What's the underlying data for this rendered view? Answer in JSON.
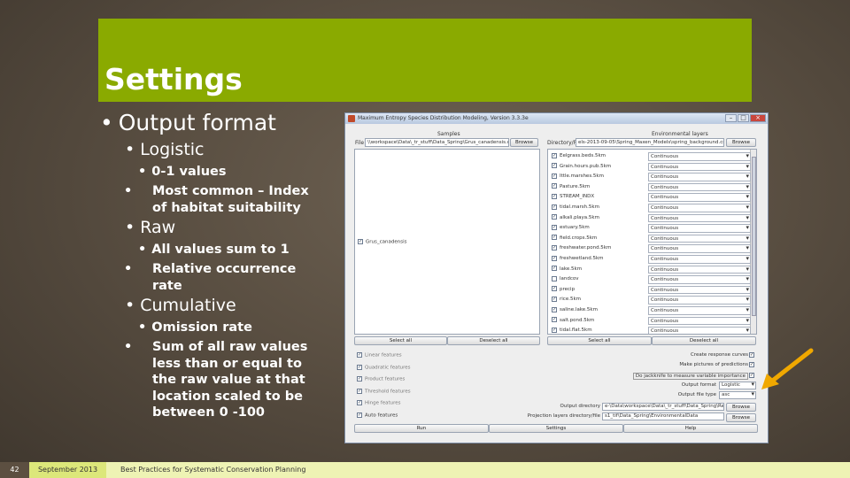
{
  "slide": {
    "title": "Settings",
    "bullets": {
      "output_format": "Output format",
      "logistic": "Logistic",
      "logistic_1": "0-1 values",
      "logistic_2": "Most common – Index of habitat suitability",
      "raw": "Raw",
      "raw_1": "All values sum to 1",
      "raw_2": "Relative occurrence rate",
      "cumulative": "Cumulative",
      "cumulative_1": "Omission rate",
      "cumulative_2": "Sum of all raw values less than or equal to the raw value at that location scaled to be between 0 -100"
    },
    "footer": {
      "page_number": "42",
      "date": "September 2013",
      "title": "Best Practices for Systematic Conservation Planning"
    },
    "colors": {
      "accent": "#8aaa00",
      "arrow": "#f0a800"
    }
  },
  "app": {
    "title": "Maximum Entropy Species Distribution Modeling, Version 3.3.3e",
    "samples": {
      "header": "Samples",
      "file_label": "File",
      "file_path": "\\\\workspace\\Data\\_tr_stuff\\Data_Spring\\Grus_canadensis.csv",
      "browse": "Browse",
      "species": [
        {
          "name": "Grus_canadensis",
          "checked": true
        }
      ]
    },
    "env": {
      "header": "Environmental layers",
      "dir_label": "Directory/File",
      "dir_path": "els-2013-09-05\\Spring_Maxen_Models\\spring_background.csv",
      "browse": "Browse",
      "layers": [
        {
          "name": "Eelgrass.beds.5km",
          "checked": true,
          "type": "Continuous"
        },
        {
          "name": "Grain.hours.pub.5km",
          "checked": true,
          "type": "Continuous"
        },
        {
          "name": "Ittle.marshes.5km",
          "checked": true,
          "type": "Continuous"
        },
        {
          "name": "Pasture.5km",
          "checked": true,
          "type": "Continuous"
        },
        {
          "name": "STREAM_INDX",
          "checked": true,
          "type": "Continuous"
        },
        {
          "name": "tidal.marsh.5km",
          "checked": true,
          "type": "Continuous"
        },
        {
          "name": "alkali.playa.5km",
          "checked": true,
          "type": "Continuous"
        },
        {
          "name": "estuary.5km",
          "checked": true,
          "type": "Continuous"
        },
        {
          "name": "field.crops.5km",
          "checked": true,
          "type": "Continuous"
        },
        {
          "name": "freshwater.pond.5km",
          "checked": true,
          "type": "Continuous"
        },
        {
          "name": "freshwetland.5km",
          "checked": true,
          "type": "Continuous"
        },
        {
          "name": "lake.5km",
          "checked": true,
          "type": "Continuous"
        },
        {
          "name": "landcov",
          "checked": false,
          "type": "Continuous"
        },
        {
          "name": "precip",
          "checked": true,
          "type": "Continuous"
        },
        {
          "name": "rice.5km",
          "checked": true,
          "type": "Continuous"
        },
        {
          "name": "saline.lake.5km",
          "checked": true,
          "type": "Continuous"
        },
        {
          "name": "salt.pond.5km",
          "checked": true,
          "type": "Continuous"
        },
        {
          "name": "tidal.flat.5km",
          "checked": true,
          "type": "Continuous"
        }
      ]
    },
    "buttons": {
      "select_all_samples": "Select all",
      "deselect_all_samples": "Deselect all",
      "select_all_layers": "Select all",
      "deselect_all_layers": "Deselect all",
      "run": "Run",
      "settings": "Settings",
      "help": "Help",
      "browse_output": "Browse",
      "browse_projection": "Browse"
    },
    "features": [
      {
        "label": "Linear features",
        "checked": true
      },
      {
        "label": "Quadratic features",
        "checked": true
      },
      {
        "label": "Product features",
        "checked": true
      },
      {
        "label": "Threshold features",
        "checked": true
      },
      {
        "label": "Hinge features",
        "checked": true
      },
      {
        "label": "Auto features",
        "checked": true
      }
    ],
    "options": {
      "response_curves": {
        "label": "Create response curves",
        "checked": true
      },
      "pictures": {
        "label": "Make pictures of predictions",
        "checked": true
      },
      "jackknife": {
        "label": "Do jackknife to measure variable importance",
        "checked": true
      },
      "output_format_label": "Output format",
      "output_format_value": "Logistic",
      "output_file_type_label": "Output file type",
      "output_file_type_value": "asc",
      "output_dir_label": "Output directory",
      "output_dir_value": "e-\\Data\\workspace\\Data\\_tr_stuff\\Data_Spring\\Results_25",
      "projection_label": "Projection layers directory/file",
      "projection_value": "s1_tif\\Data_Spring\\EnvironmentalData"
    }
  }
}
